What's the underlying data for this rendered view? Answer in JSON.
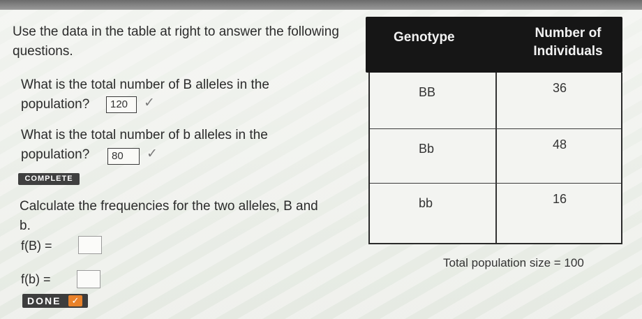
{
  "instructions": "Use the data in the table at right to answer the following questions.",
  "questions": [
    {
      "text": "What is the total number of B alleles in the population?",
      "answer": "120"
    },
    {
      "text": "What is the total number of b alleles in the population?",
      "answer": "80"
    }
  ],
  "complete_badge": "COMPLETE",
  "check_mark": "✓",
  "frequency_prompt": "Calculate the frequencies for the two alleles, B and b.",
  "freq_labels": {
    "B": "f(B) =",
    "b": "f(b) ="
  },
  "done_button": {
    "label": "DONE",
    "check": "✓"
  },
  "table": {
    "headers": {
      "genotype": "Genotype",
      "number": "Number of Individuals"
    },
    "rows": [
      {
        "genotype": "BB",
        "count": "36"
      },
      {
        "genotype": "Bb",
        "count": "48"
      },
      {
        "genotype": "bb",
        "count": "16"
      }
    ],
    "total": "Total population size = 100"
  },
  "colors": {
    "done_check": "#e9822a",
    "header_bg": "#161616"
  }
}
